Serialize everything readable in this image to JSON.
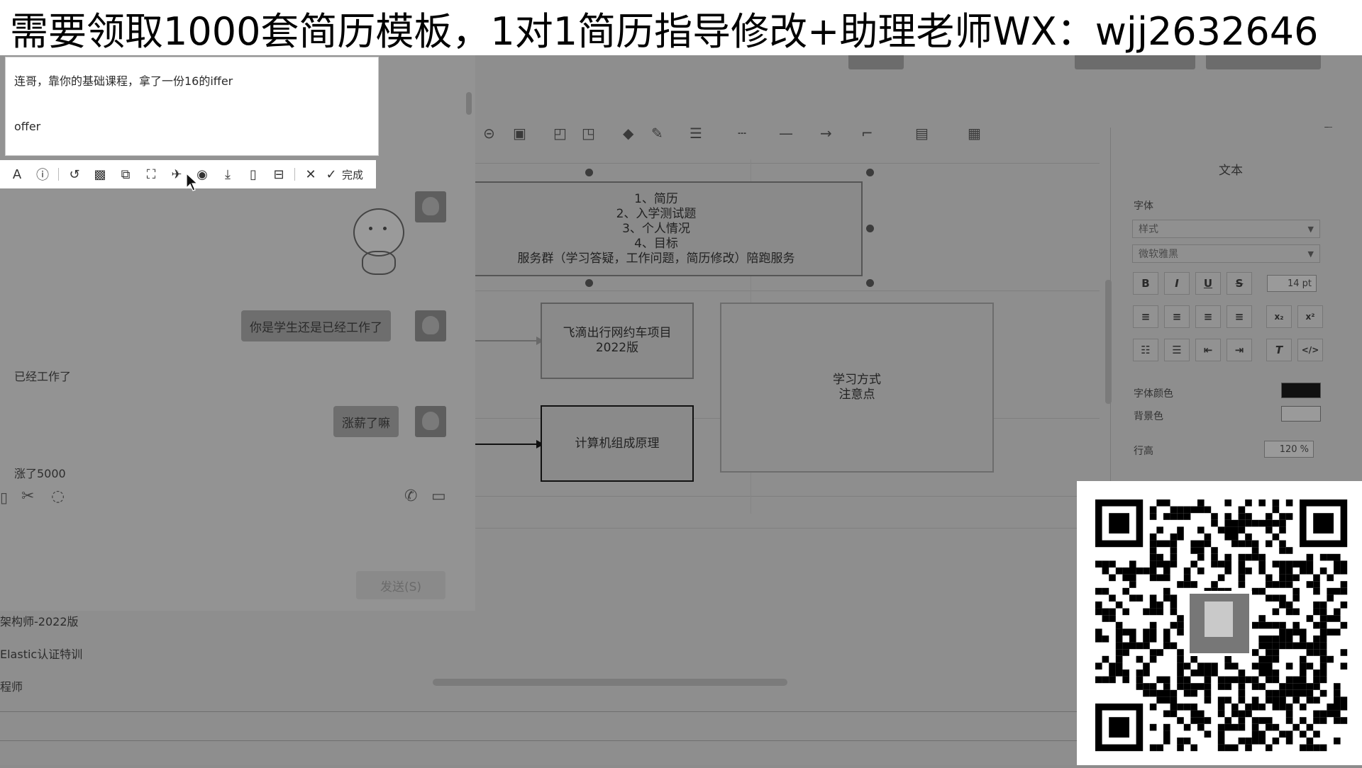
{
  "banner": {
    "text": "需要领取1000套简历模板，1对1简历指导修改+助理老师WX：wjj2632646"
  },
  "popup": {
    "line1": "连哥，靠你的基础课程，拿了一份16的iffer",
    "line2": "offer"
  },
  "snip_toolbar": {
    "items": [
      "text-icon",
      "info-icon",
      "undo-icon",
      "mosaic-icon",
      "translate-icon",
      "ocr-icon",
      "pin-icon",
      "record-icon",
      "download-icon",
      "save-icon",
      "bookmark-icon",
      "close-icon"
    ],
    "done_label": "完成"
  },
  "chat": {
    "bubble1": "你是学生还是已经工作了",
    "reply1": "已经工作了",
    "bubble2": "涨薪了嘛",
    "reply2": "涨了5000",
    "send_label": "发送(S)"
  },
  "sidebar_list": {
    "item1": "架构师-2022版",
    "item2": "Elastic认证特训",
    "item3": "程师"
  },
  "diagram": {
    "note_text": "1、简历\n2、入学测试题\n3、个人情况\n4、目标\n服务群（学习答疑，工作问题，简历修改）陪跑服务",
    "box1": "飞滴出行网约车项目\n2022版",
    "box2": "计算机组成原理",
    "note2": "学习方式\n注意点"
  },
  "format_panel": {
    "title": "文本",
    "font_label": "字体",
    "style_placeholder": "样式",
    "font_name": "微软雅黑",
    "font_size": "14 pt",
    "bold": "B",
    "italic": "I",
    "underline": "U",
    "strike": "S",
    "font_color_label": "字体颜色",
    "bg_color_label": "背景色",
    "line_height_label": "行高",
    "line_height": "120 %",
    "font_color": "#000000",
    "bg_color": "#ffffff"
  }
}
